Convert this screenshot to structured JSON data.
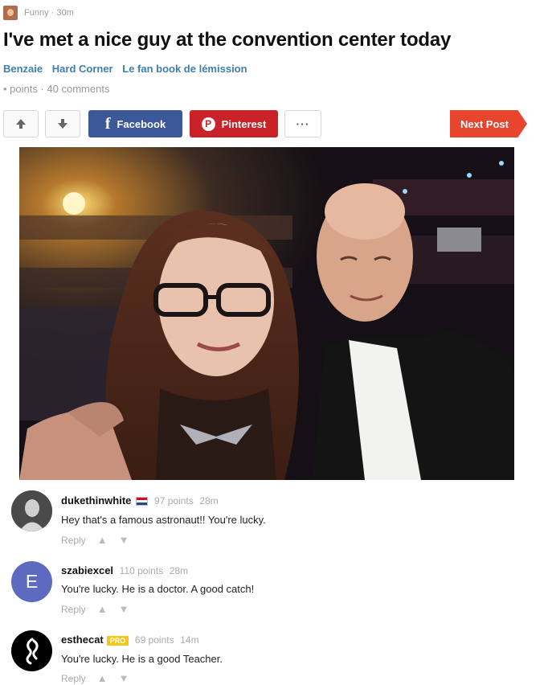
{
  "post": {
    "category": "Funny",
    "age": "30m",
    "title": "I've met a nice guy at the convention center today",
    "tags": [
      "Benzaie",
      "Hard Corner",
      "Le fan book de lémission"
    ],
    "stats": "• points · 40 comments"
  },
  "toolbar": {
    "upvote_icon": "arrow-up-icon",
    "downvote_icon": "arrow-down-icon",
    "facebook_label": "Facebook",
    "pinterest_label": "Pinterest",
    "more_label": "···",
    "next_label": "Next Post"
  },
  "colors": {
    "facebook": "#3b5998",
    "pinterest": "#c92228",
    "next": "#e8452f",
    "tag": "#3e7fb1"
  },
  "comments": [
    {
      "username": "dukethinwhite",
      "points": "97 points",
      "age": "28m",
      "text": "Hey that's a famous astronaut!! You're lucky.",
      "reply": "Reply"
    },
    {
      "username": "szabiexcel",
      "avatar_letter": "E",
      "points": "110 points",
      "age": "28m",
      "text": "You're lucky. He is a doctor. A good catch!",
      "reply": "Reply"
    },
    {
      "username": "esthecat",
      "badge": "PRO",
      "points": "69 points",
      "age": "14m",
      "text": "You're lucky. He is a good Teacher.",
      "reply": "Reply"
    }
  ]
}
